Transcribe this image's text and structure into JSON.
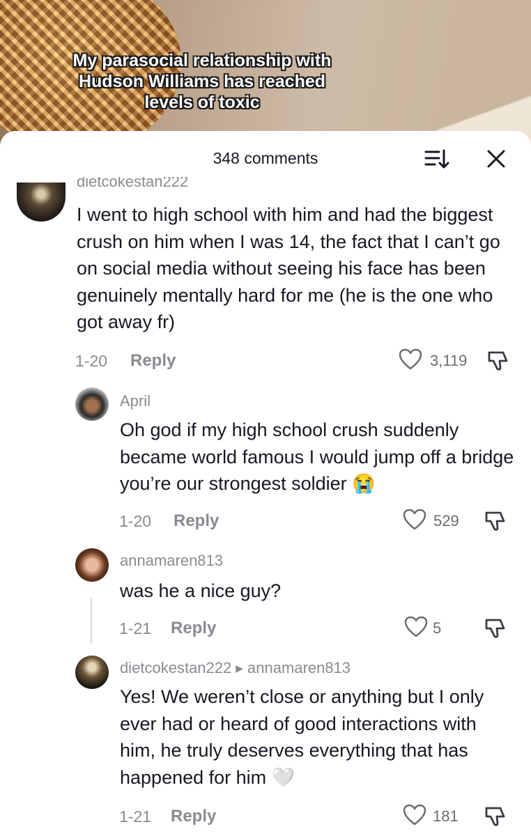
{
  "video": {
    "overlay_text": "My parasocial relationship with Hudson Williams has reached levels of toxic"
  },
  "comments_sheet": {
    "count_label": "348 comments"
  },
  "comments": [
    {
      "username": "dietcokestan222",
      "text": "I went to high school with him and had the biggest crush on him when I was 14, the fact that I can’t go on social media without seeing his face has been genuinely mentally hard for me (he is the one who got away fr)",
      "date": "1-20",
      "reply_label": "Reply",
      "likes": "3,119"
    },
    {
      "username": "April",
      "text": "Oh god if my high school crush suddenly became world famous I would jump off a bridge you’re our strongest soldier",
      "emoji": "😭",
      "date": "1-20",
      "reply_label": "Reply",
      "likes": "529"
    },
    {
      "username": "annamaren813",
      "text": "was he a nice guy?",
      "date": "1-21",
      "reply_label": "Reply",
      "likes": "5"
    },
    {
      "username": "dietcokestan222",
      "reply_to": "annamaren813",
      "text": "Yes! We weren’t close or anything but I only ever had or heard of good interactions with him, he truly deserves everything that has happened for him",
      "emoji": "🤍",
      "date": "1-21",
      "reply_label": "Reply",
      "likes": "181"
    }
  ],
  "icons": [
    "sort-icon",
    "close-icon",
    "heart-icon",
    "dislike-icon",
    "reply-arrow-icon"
  ]
}
